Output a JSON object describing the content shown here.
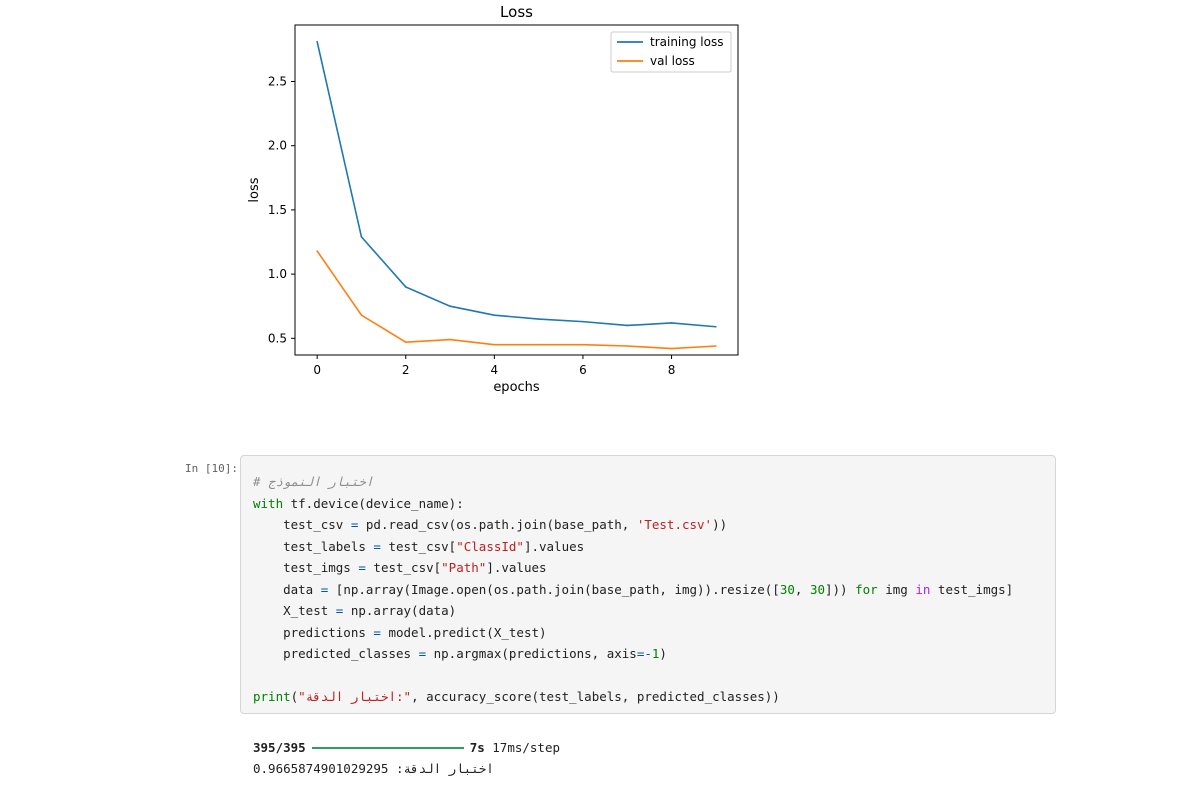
{
  "chart_data": {
    "type": "line",
    "title": "Loss",
    "xlabel": "epochs",
    "ylabel": "loss",
    "x": [
      0,
      1,
      2,
      3,
      4,
      5,
      6,
      7,
      8,
      9
    ],
    "series": [
      {
        "name": "training loss",
        "color": "#1f77b4",
        "values": [
          2.81,
          1.29,
          0.9,
          0.75,
          0.68,
          0.65,
          0.63,
          0.6,
          0.62,
          0.59
        ]
      },
      {
        "name": "val loss",
        "color": "#ff7f0e",
        "values": [
          1.18,
          0.68,
          0.47,
          0.49,
          0.45,
          0.45,
          0.45,
          0.44,
          0.42,
          0.44
        ]
      }
    ],
    "xlim": [
      -0.5,
      9.5
    ],
    "ylim": [
      0.37,
      2.94
    ],
    "xticks": [
      0,
      2,
      4,
      6,
      8
    ],
    "yticks": [
      0.5,
      1.0,
      1.5,
      2.0,
      2.5
    ],
    "ytick_labels": [
      "0.5",
      "1.0",
      "1.5",
      "2.0",
      "2.5"
    ],
    "legend_position": "top-right",
    "grid": false
  },
  "cell": {
    "prompt": "In [10]:"
  },
  "output": {
    "progress_count": "395/395",
    "progress_time": "7s",
    "progress_step": "17ms/step",
    "result_label": "اختبار الدقة:",
    "result_value": "0.9665874901029295"
  }
}
